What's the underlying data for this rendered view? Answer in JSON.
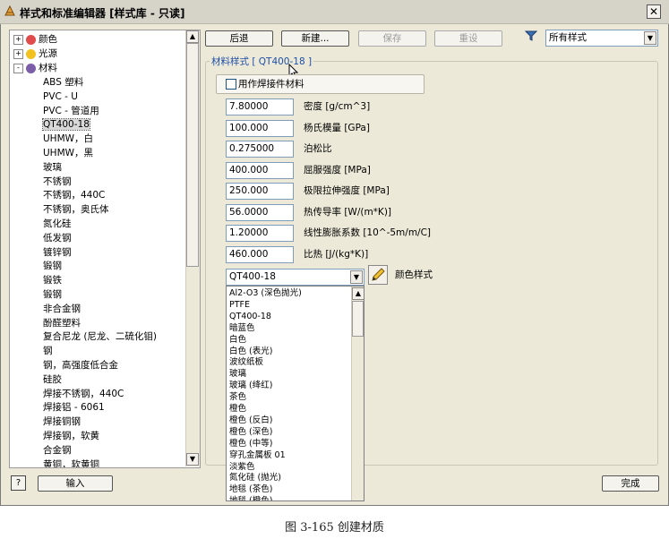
{
  "window": {
    "title": "样式和标准编辑器 [样式库 - 只读]"
  },
  "tree": {
    "top_items": [
      {
        "label": "颜色",
        "expander": "+"
      },
      {
        "label": "光源",
        "expander": "+"
      },
      {
        "label": "材料",
        "expander": "-"
      }
    ],
    "materials": [
      "ABS 塑料",
      "PVC - U",
      "PVC - 管道用",
      "QT400-18",
      "UHMW，白",
      "UHMW，黑",
      "玻璃",
      "不锈钢",
      "不锈钢，440C",
      "不锈钢，奥氏体",
      "氮化硅",
      "低发钢",
      "镀锌钢",
      "锻钢",
      "锻铁",
      "锻钢",
      "非合金钢",
      "酚醛塑料",
      "复合尼龙 (尼龙、二硫化钼)",
      "钢",
      "钢，高强度低合金",
      "硅胶",
      "焊接不锈钢，440C",
      "焊接铝 - 6061",
      "焊接铜钢",
      "焊接钢，软黄",
      "合金钢",
      "黄铜，软黄铜"
    ],
    "selected_index": 3
  },
  "toolbar": {
    "back": "后退",
    "new": "新建...",
    "save": "保存",
    "reset": "重设",
    "filter_value": "所有样式"
  },
  "group": {
    "title": "材料样式 [ QT400-18 ]"
  },
  "weld": {
    "label": "用作焊接件材料"
  },
  "properties": [
    {
      "value": "7.80000",
      "label": "密度 [g/cm^3]"
    },
    {
      "value": "100.000",
      "label": "杨氏模量 [GPa]"
    },
    {
      "value": "0.275000",
      "label": "泊松比"
    },
    {
      "value": "400.000",
      "label": "屈服强度 [MPa]"
    },
    {
      "value": "250.000",
      "label": "极限拉伸强度 [MPa]"
    },
    {
      "value": "56.0000",
      "label": "热传导率 [W/(m*K)]"
    },
    {
      "value": "1.20000",
      "label": "线性膨胀系数 [10^-5m/m/C]"
    },
    {
      "value": "460.000",
      "label": "比热 [J/(kg*K)]"
    }
  ],
  "color_style": {
    "selected": "QT400-18",
    "label": "颜色样式",
    "options": [
      "Al2-O3 (深色抛光)",
      "PTFE",
      "QT400-18",
      "暗蓝色",
      "白色",
      "白色 (表光)",
      "波纹纸板",
      "玻璃",
      "玻璃 (绛红)",
      "茶色",
      "橙色",
      "橙色 (反白)",
      "橙色 (深色)",
      "橙色 (中等)",
      "穿孔金属板 01",
      "淡紫色",
      "氮化硅 (抛光)",
      "地毯 (茶色)",
      "地毯 (橙色)"
    ]
  },
  "footer": {
    "import": "输入",
    "done": "完成"
  },
  "caption": "图 3-165  创建材质"
}
